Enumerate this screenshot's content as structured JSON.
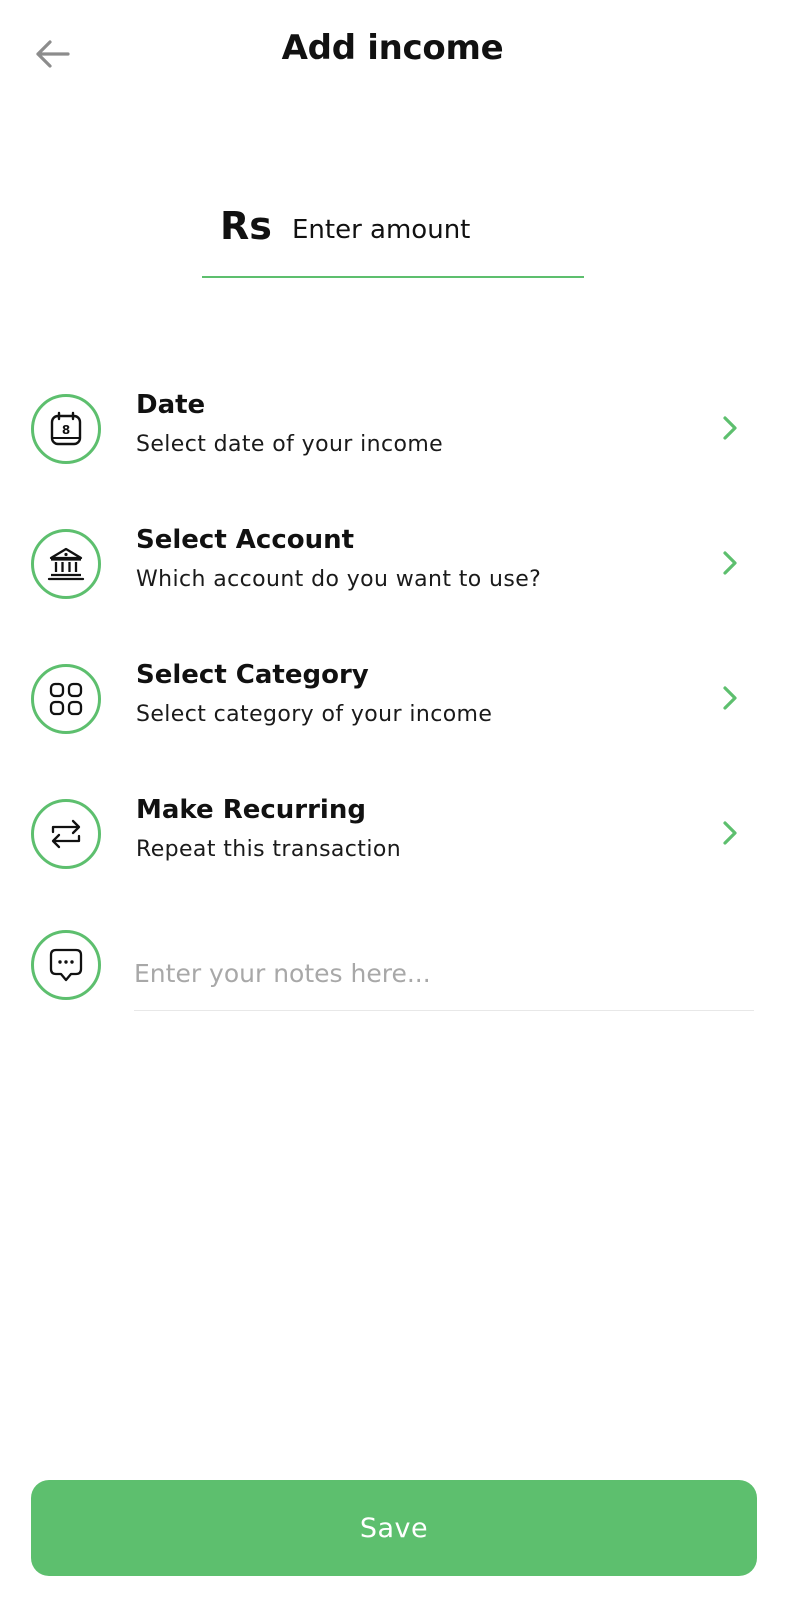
{
  "header": {
    "title": "Add income",
    "back_icon": "arrow-left-icon"
  },
  "amount": {
    "currency": "Rs",
    "placeholder": "Enter amount",
    "value": ""
  },
  "options": [
    {
      "icon": "calendar-icon",
      "calendar_day": "8",
      "title": "Date",
      "subtitle": "Select date of your income"
    },
    {
      "icon": "bank-icon",
      "title": "Select Account",
      "subtitle": "Which account do you want to use?"
    },
    {
      "icon": "category-grid-icon",
      "title": "Select Category",
      "subtitle": "Select category of your income"
    },
    {
      "icon": "repeat-icon",
      "title": "Make Recurring",
      "subtitle": "Repeat this transaction"
    }
  ],
  "notes": {
    "icon": "chat-bubble-icon",
    "placeholder": "Enter your notes here...",
    "value": ""
  },
  "save_label": "Save",
  "colors": {
    "accent": "#5dbf6e",
    "text": "#111111",
    "placeholder": "#a8a8a8",
    "back_arrow": "#8c8c8c"
  }
}
